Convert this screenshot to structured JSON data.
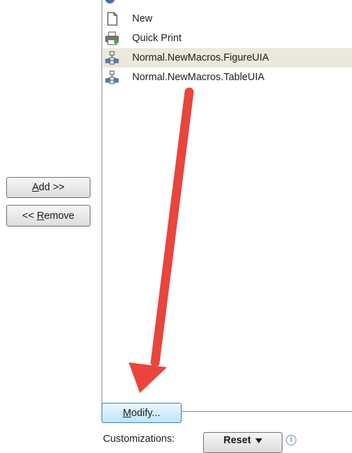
{
  "list": {
    "items": [
      {
        "label": "New",
        "icon": "new-document-icon",
        "selected": false
      },
      {
        "label": "Quick Print",
        "icon": "printer-icon",
        "selected": false
      },
      {
        "label": "Normal.NewMacros.FigureUIA",
        "icon": "macro-icon",
        "selected": true
      },
      {
        "label": "Normal.NewMacros.TableUIA",
        "icon": "macro-icon",
        "selected": false
      }
    ]
  },
  "buttons": {
    "add_mnemonic": "A",
    "add_rest": "dd >>",
    "remove_prefix": "<< ",
    "remove_mnemonic": "R",
    "remove_rest": "emove",
    "modify_mnemonic": "M",
    "modify_rest": "odify...",
    "reset_label": "Reset"
  },
  "customizations": {
    "label": "Customizations:"
  },
  "annotation": {
    "arrow_color": "#e8453c"
  }
}
